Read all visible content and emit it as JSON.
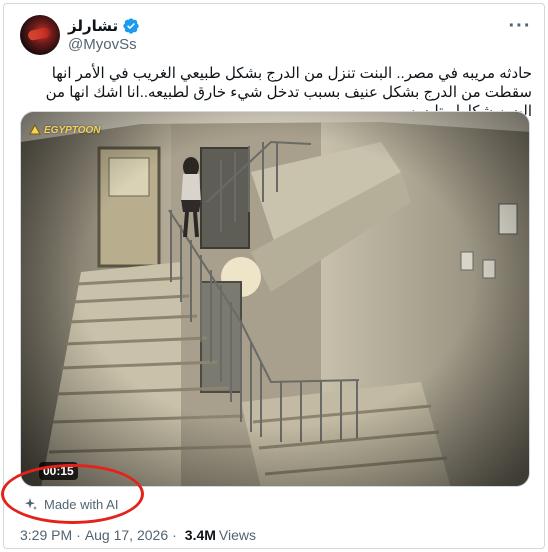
{
  "author": {
    "display_name": "تشارلز",
    "handle": "@MyovSs",
    "verified_icon": "verified-badge-icon",
    "verified_color": "#1d9bf0"
  },
  "menu": {
    "icon": "more-horizontal-icon",
    "label": "···"
  },
  "tweet": {
    "text": "حادثه مريبه في مصر.. البنت تنزل من الدرج بشكل طبيعي الغريب في الأمر انها سقطت من الدرج بشكل عنيف بسبب تدخل شيء خارق لطبيعه..انا اشك انها من البسه شكلها متلبسه"
  },
  "media": {
    "type": "video",
    "watermark": "EGYPTOON",
    "duration": "00:15"
  },
  "ai_label": {
    "icon": "sparkle-icon",
    "text": "Made with AI",
    "highlight_color": "#e3231b"
  },
  "meta": {
    "time": "3:29 PM",
    "separator": "·",
    "date": "Aug 17, 2026",
    "views_count": "3.4M",
    "views_label": "Views"
  }
}
